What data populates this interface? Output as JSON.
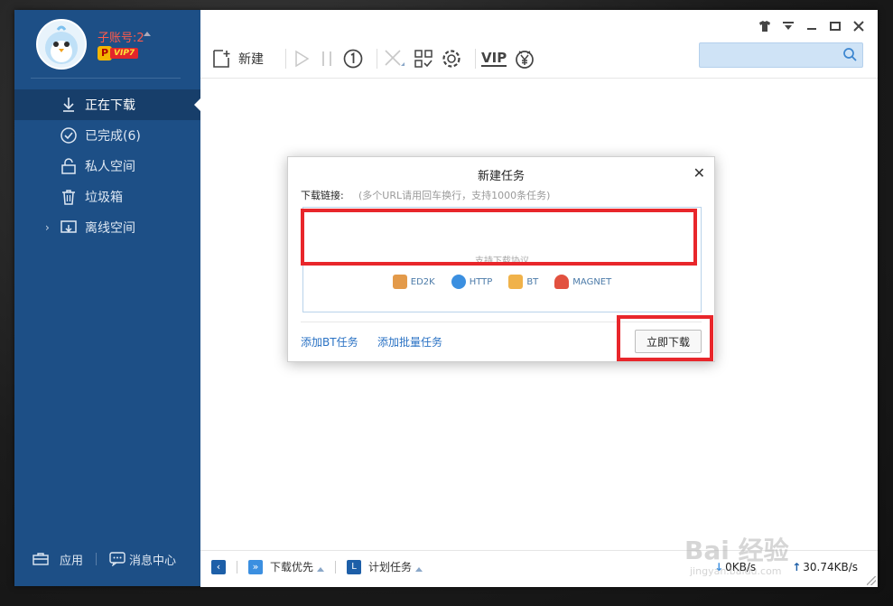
{
  "account": {
    "username": "子账号:2",
    "vip_badge_p": "P",
    "vip_level": "VIP7"
  },
  "sidebar": {
    "items": [
      {
        "label": "正在下载",
        "icon": "download-arrow-icon",
        "active": true
      },
      {
        "label": "已完成(6)",
        "icon": "check-circle-icon"
      },
      {
        "label": "私人空间",
        "icon": "lock-icon"
      },
      {
        "label": "垃圾箱",
        "icon": "trash-icon"
      },
      {
        "label": "离线空间",
        "icon": "cloud-download-icon",
        "expandable": true
      }
    ],
    "bottom": {
      "apps_label": "应用",
      "messages_label": "消息中心"
    }
  },
  "toolbar": {
    "new_label": "新建",
    "vip_label": "VIP"
  },
  "statusbar": {
    "priority_label": "下载优先",
    "schedule_label": "计划任务",
    "download_speed": "0KB/s",
    "upload_speed": "30.74KB/s"
  },
  "dialog": {
    "title": "新建任务",
    "link_label": "下载链接:",
    "link_hint": "(多个URL请用回车换行，支持1000条任务)",
    "protocol_hint": "支持下载协议",
    "protocols": [
      "ED2K",
      "HTTP",
      "BT",
      "MAGNET"
    ],
    "add_bt_label": "添加BT任务",
    "add_batch_label": "添加批量任务",
    "download_now_label": "立即下载"
  },
  "watermark": {
    "main": "Bai 经验",
    "sub": "jingyan.baidu.com"
  },
  "colors": {
    "sidebar": "#1d4f86",
    "accent_red": "#e8262b",
    "link_blue": "#2a72c4"
  }
}
